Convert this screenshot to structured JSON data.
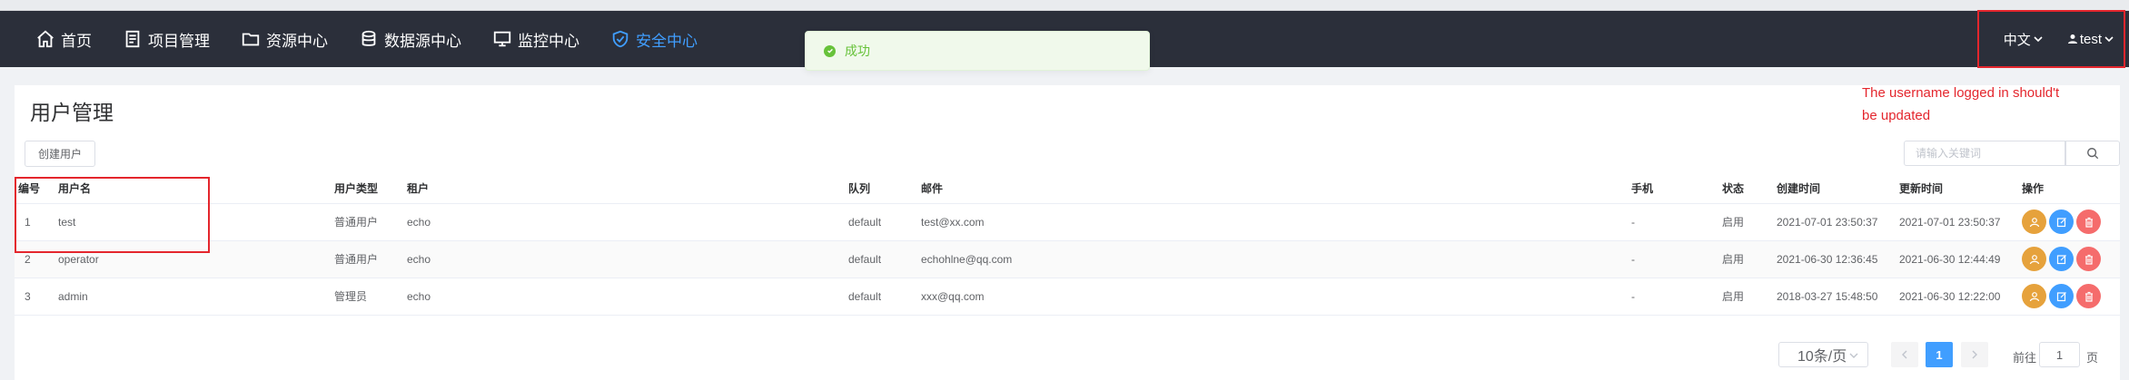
{
  "nav": {
    "items": [
      {
        "label": "首页",
        "icon": "home-icon"
      },
      {
        "label": "项目管理",
        "icon": "document-icon"
      },
      {
        "label": "资源中心",
        "icon": "folder-icon"
      },
      {
        "label": "数据源中心",
        "icon": "database-icon"
      },
      {
        "label": "监控中心",
        "icon": "monitor-icon"
      },
      {
        "label": "安全中心",
        "icon": "shield-icon",
        "active": true
      }
    ],
    "language": "中文",
    "user": "test"
  },
  "toast": {
    "message": "成功",
    "type": "success"
  },
  "annotation": {
    "text": "The username logged in should't be updated"
  },
  "page": {
    "title": "用户管理",
    "create_button": "创建用户"
  },
  "search": {
    "placeholder": "请输入关键词"
  },
  "table": {
    "headers": [
      "编号",
      "用户名",
      "用户类型",
      "租户",
      "队列",
      "邮件",
      "手机",
      "状态",
      "创建时间",
      "更新时间",
      "操作"
    ],
    "rows": [
      [
        "1",
        "test",
        "普通用户",
        "echo",
        "default",
        "test@xx.com",
        "-",
        "启用",
        "2021-07-01 23:50:37",
        "2021-07-01 23:50:37"
      ],
      [
        "2",
        "operator",
        "普通用户",
        "echo",
        "default",
        "echohlne@qq.com",
        "-",
        "启用",
        "2021-06-30 12:36:45",
        "2021-06-30 12:44:49"
      ],
      [
        "3",
        "admin",
        "管理员",
        "echo",
        "default",
        "xxx@qq.com",
        "-",
        "启用",
        "2018-03-27 15:48:50",
        "2021-06-30 12:22:00"
      ]
    ]
  },
  "pagination": {
    "page_size": "10条/页",
    "current_page": "1",
    "goto_label": "前往",
    "goto_value": "1",
    "page_suffix": "页"
  },
  "colors": {
    "accent": "#409eff",
    "navbar": "#2b2f3a",
    "success": "#67c23a",
    "warning": "#e6a23c",
    "danger": "#f56c6c",
    "highlight": "#e4262d"
  }
}
